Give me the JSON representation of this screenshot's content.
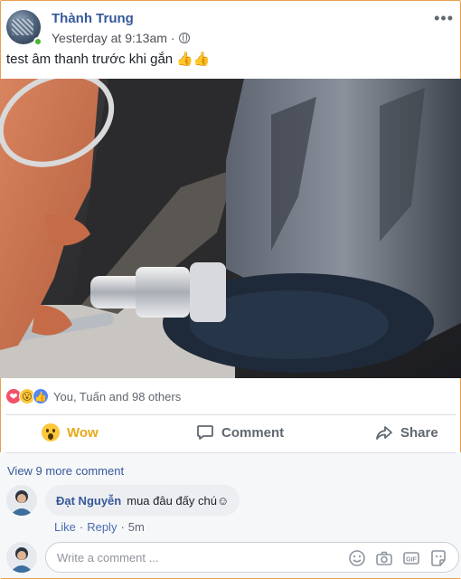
{
  "post": {
    "author": "Thành Trung",
    "timestamp": "Yesterday at 9:13am",
    "separator": "·",
    "more_label": "•••",
    "text": "test âm thanh trước khi gắn",
    "emoji": "👍👍",
    "privacy_icon": "globe-icon"
  },
  "reactions": {
    "icons": [
      "love-reaction-icon",
      "wow-reaction-icon",
      "like-reaction-icon"
    ],
    "summary": "You, Tuấn and 98 others"
  },
  "actions": {
    "wow_label": "Wow",
    "comment_label": "Comment",
    "share_label": "Share"
  },
  "comments": {
    "view_more": "View 9 more comment",
    "items": [
      {
        "author": "Đạt Nguyễn",
        "text": "mua đâu đấy chú☺",
        "like_label": "Like",
        "reply_label": "Reply",
        "time": "5m"
      }
    ]
  },
  "composer": {
    "placeholder": "Write a comment ...",
    "tools": [
      "emoji-icon",
      "camera-icon",
      "gif-icon",
      "sticker-icon"
    ]
  },
  "colors": {
    "link": "#365899",
    "wow": "#e8a81a",
    "muted": "#606770",
    "frame": "#e9a04f"
  }
}
